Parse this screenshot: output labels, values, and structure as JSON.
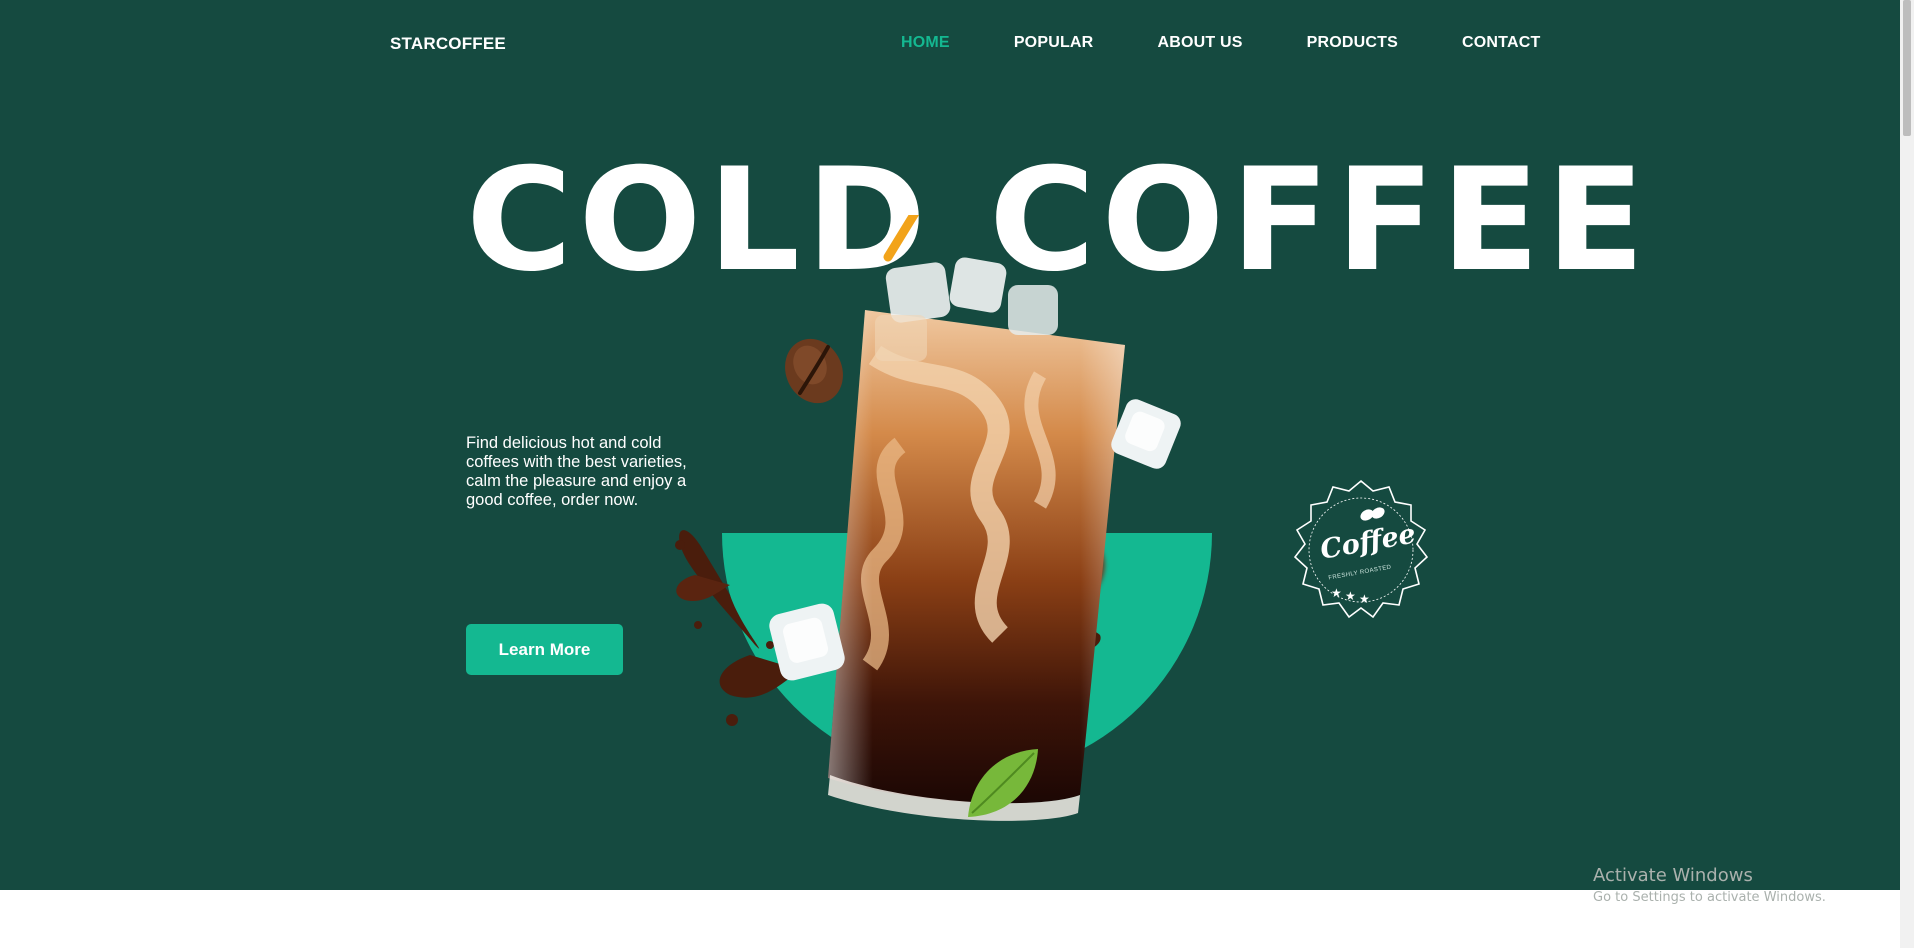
{
  "header": {
    "brand": "STARCOFFEE",
    "nav": [
      {
        "label": "HOME",
        "active": true
      },
      {
        "label": "POPULAR",
        "active": false
      },
      {
        "label": "ABOUT US",
        "active": false
      },
      {
        "label": "PRODUCTS",
        "active": false
      },
      {
        "label": "CONTACT",
        "active": false
      }
    ]
  },
  "hero": {
    "headline": "COLD COFFEE",
    "tagline": "Find delicious hot and cold coffees with the best varieties, calm the pleasure and enjoy a good coffee, order now.",
    "cta_label": "Learn More",
    "badge_word": "Coffee",
    "badge_subtext": "FRESHLY ROASTED"
  },
  "os_watermark": {
    "title": "Activate Windows",
    "subtitle": "Go to Settings to activate Windows."
  },
  "colors": {
    "hero_background": "#154a40",
    "accent": "#14b891",
    "text": "#ffffff"
  }
}
